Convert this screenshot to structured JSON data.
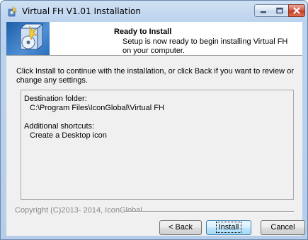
{
  "window": {
    "title": "Virtual FH V1.01 Installation"
  },
  "caption_buttons": {
    "minimize_icon": "minimize-icon",
    "maximize_icon": "maximize-icon",
    "close_icon": "close-icon"
  },
  "header": {
    "title": "Ready to Install",
    "description": "Setup is now ready to begin installing Virtual FH on your computer."
  },
  "content": {
    "intro": "Click Install to continue with the installation, or click Back if you want to review or change any settings.",
    "memo": {
      "destination_label": "Destination folder:",
      "destination_value": "C:\\Program Files\\IconGlobal\\Virtual FH",
      "shortcuts_label": "Additional shortcuts:",
      "shortcuts_value": "Create a Desktop icon"
    }
  },
  "footer": {
    "copyright": "Copyright (C)2013- 2014, IconGlobal",
    "back_label": "< Back",
    "install_label": "Install",
    "cancel_label": "Cancel"
  },
  "colors": {
    "title_gradient_top": "#cfe0f3",
    "close_button": "#c43b22",
    "panel_background": "#f0f0f0",
    "default_button_border": "#3c7fb1"
  }
}
